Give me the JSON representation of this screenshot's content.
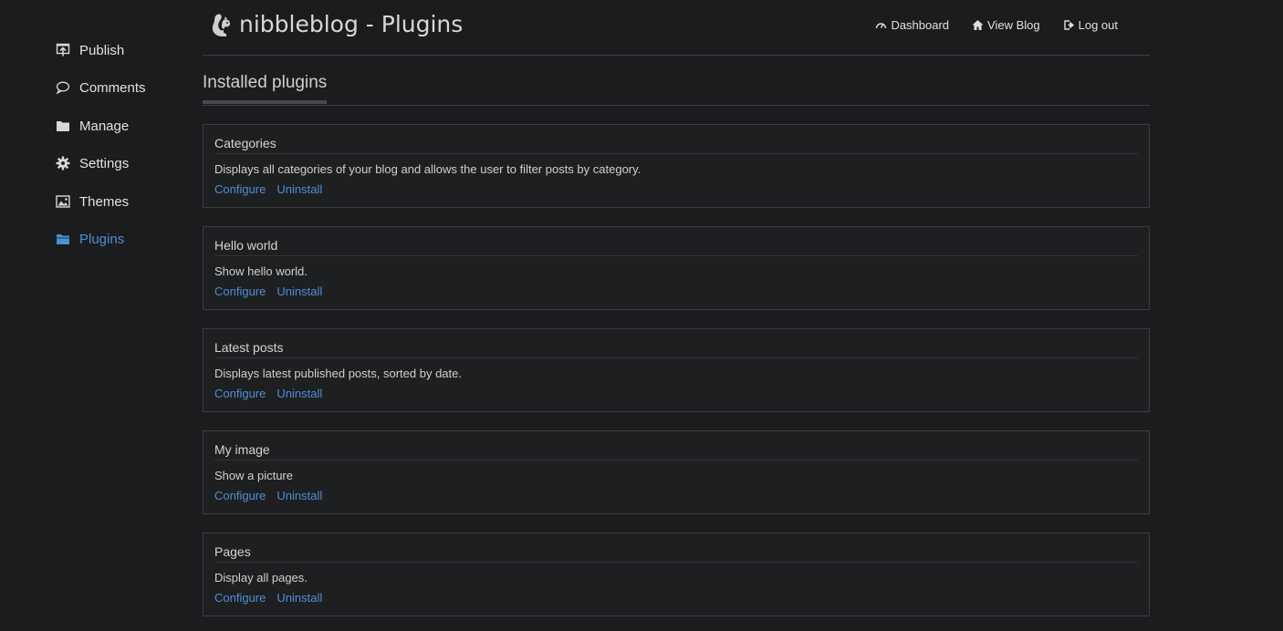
{
  "sidebar": {
    "items": [
      {
        "label": "Publish",
        "icon": "publish-icon"
      },
      {
        "label": "Comments",
        "icon": "comment-icon"
      },
      {
        "label": "Manage",
        "icon": "folder-icon"
      },
      {
        "label": "Settings",
        "icon": "gear-icon"
      },
      {
        "label": "Themes",
        "icon": "image-icon"
      },
      {
        "label": "Plugins",
        "icon": "folder-open-icon",
        "active": true
      }
    ]
  },
  "header": {
    "title": "nibbleblog - Plugins",
    "logo_icon": "squirrel-logo-icon",
    "nav": [
      {
        "label": "Dashboard",
        "icon": "dashboard-icon"
      },
      {
        "label": "View Blog",
        "icon": "home-icon"
      },
      {
        "label": "Log out",
        "icon": "logout-icon"
      }
    ]
  },
  "section": {
    "title": "Installed plugins"
  },
  "plugins": [
    {
      "name": "Categories",
      "description": "Displays all categories of your blog and allows the user to filter posts by category.",
      "configure": "Configure",
      "uninstall": "Uninstall"
    },
    {
      "name": "Hello world",
      "description": "Show hello world.",
      "configure": "Configure",
      "uninstall": "Uninstall"
    },
    {
      "name": "Latest posts",
      "description": "Displays latest published posts, sorted by date.",
      "configure": "Configure",
      "uninstall": "Uninstall"
    },
    {
      "name": "My image",
      "description": "Show a picture",
      "configure": "Configure",
      "uninstall": "Uninstall"
    },
    {
      "name": "Pages",
      "description": "Display all pages.",
      "configure": "Configure",
      "uninstall": "Uninstall"
    }
  ],
  "colors": {
    "background": "#1b1c1e",
    "accent": "#4c8fd4",
    "border": "#3c3d40"
  }
}
